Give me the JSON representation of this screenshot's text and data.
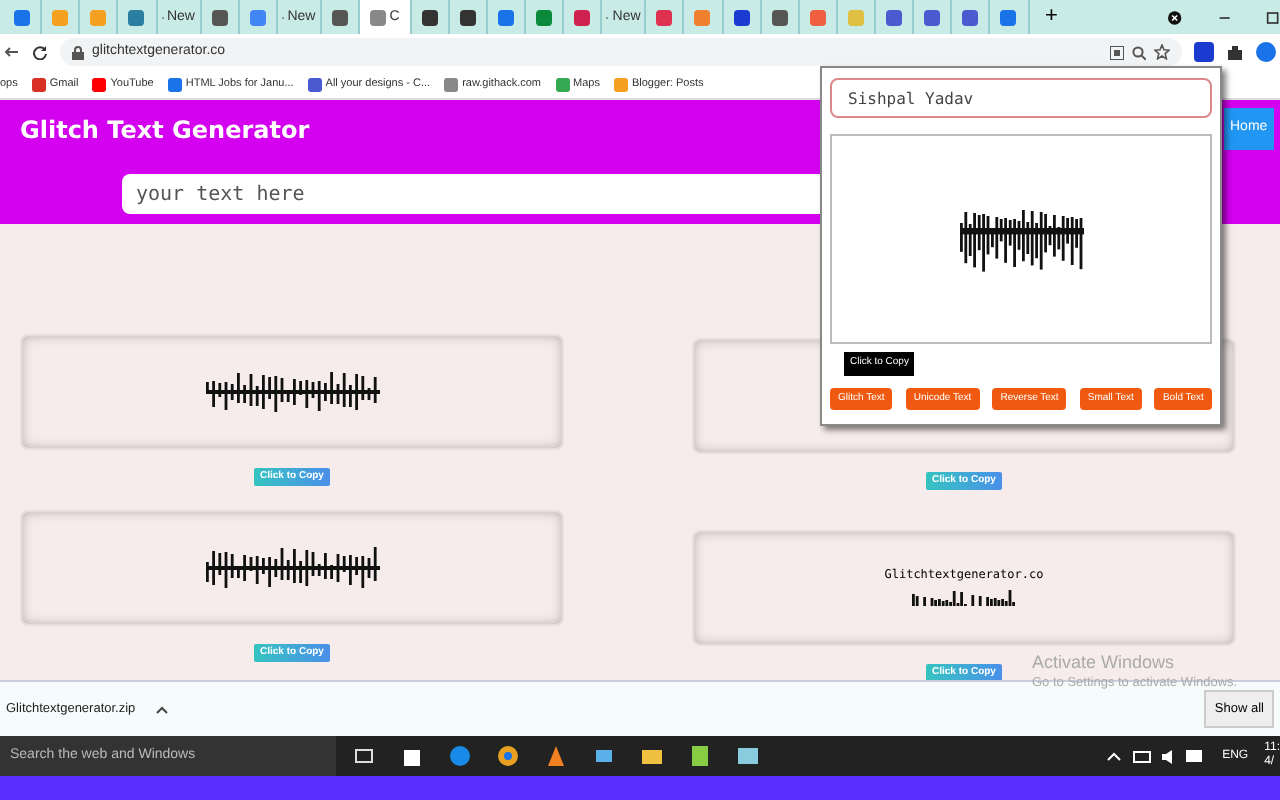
{
  "browser": {
    "tabs": [
      {
        "selected": false
      },
      {
        "selected": false
      },
      {
        "selected": false
      },
      {
        "selected": false
      },
      {
        "label": "New",
        "selected": false
      },
      {
        "selected": false
      },
      {
        "selected": false
      },
      {
        "label": "New",
        "selected": false
      },
      {
        "selected": false
      },
      {
        "label": "C",
        "selected": true
      },
      {
        "selected": false
      },
      {
        "selected": false
      },
      {
        "selected": false
      },
      {
        "selected": false
      },
      {
        "selected": false
      },
      {
        "label": "New",
        "selected": false
      },
      {
        "selected": false
      },
      {
        "selected": false
      },
      {
        "selected": false
      },
      {
        "selected": false
      },
      {
        "selected": false
      },
      {
        "selected": false
      },
      {
        "selected": false
      },
      {
        "selected": false
      },
      {
        "selected": false
      },
      {
        "selected": false
      }
    ],
    "new_tab": "+",
    "url": "glitchtextgenerator.co",
    "bookmarks": [
      "ops",
      "Gmail",
      "YouTube",
      "HTML Jobs for Janu...",
      "All your designs - C...",
      "raw.githack.com",
      "Maps",
      "Blogger: Posts"
    ]
  },
  "page": {
    "title": "Glitch Text Generator",
    "input": {
      "placeholder": "your text here"
    },
    "home": "Home",
    "card_columns": [
      {
        "cards": [
          {
            "copy": "Click to Copy"
          },
          {
            "copy": "Click to Copy"
          }
        ]
      },
      {
        "cards": [
          {
            "copy": "Click to Copy"
          },
          {
            "caption": "Glitchtextgenerator.co",
            "copy": "Click to Copy"
          }
        ]
      }
    ]
  },
  "popup": {
    "input": "Sishpal Yadav",
    "copy": "Click to Copy",
    "buttons": [
      "Glitch Text",
      "Unicode Text",
      "Reverse Text",
      "Small Text",
      "Bold Text"
    ]
  },
  "watermark_os": {
    "title": "Activate Windows",
    "text": "Go to Settings to activate Windows."
  },
  "downloads": {
    "file": "Glitchtextgenerator.zip",
    "show_all": "Show all"
  },
  "taskbar": {
    "search": "Search the web and Windows",
    "language": "ENG",
    "time": "11:",
    "date": "4/"
  }
}
